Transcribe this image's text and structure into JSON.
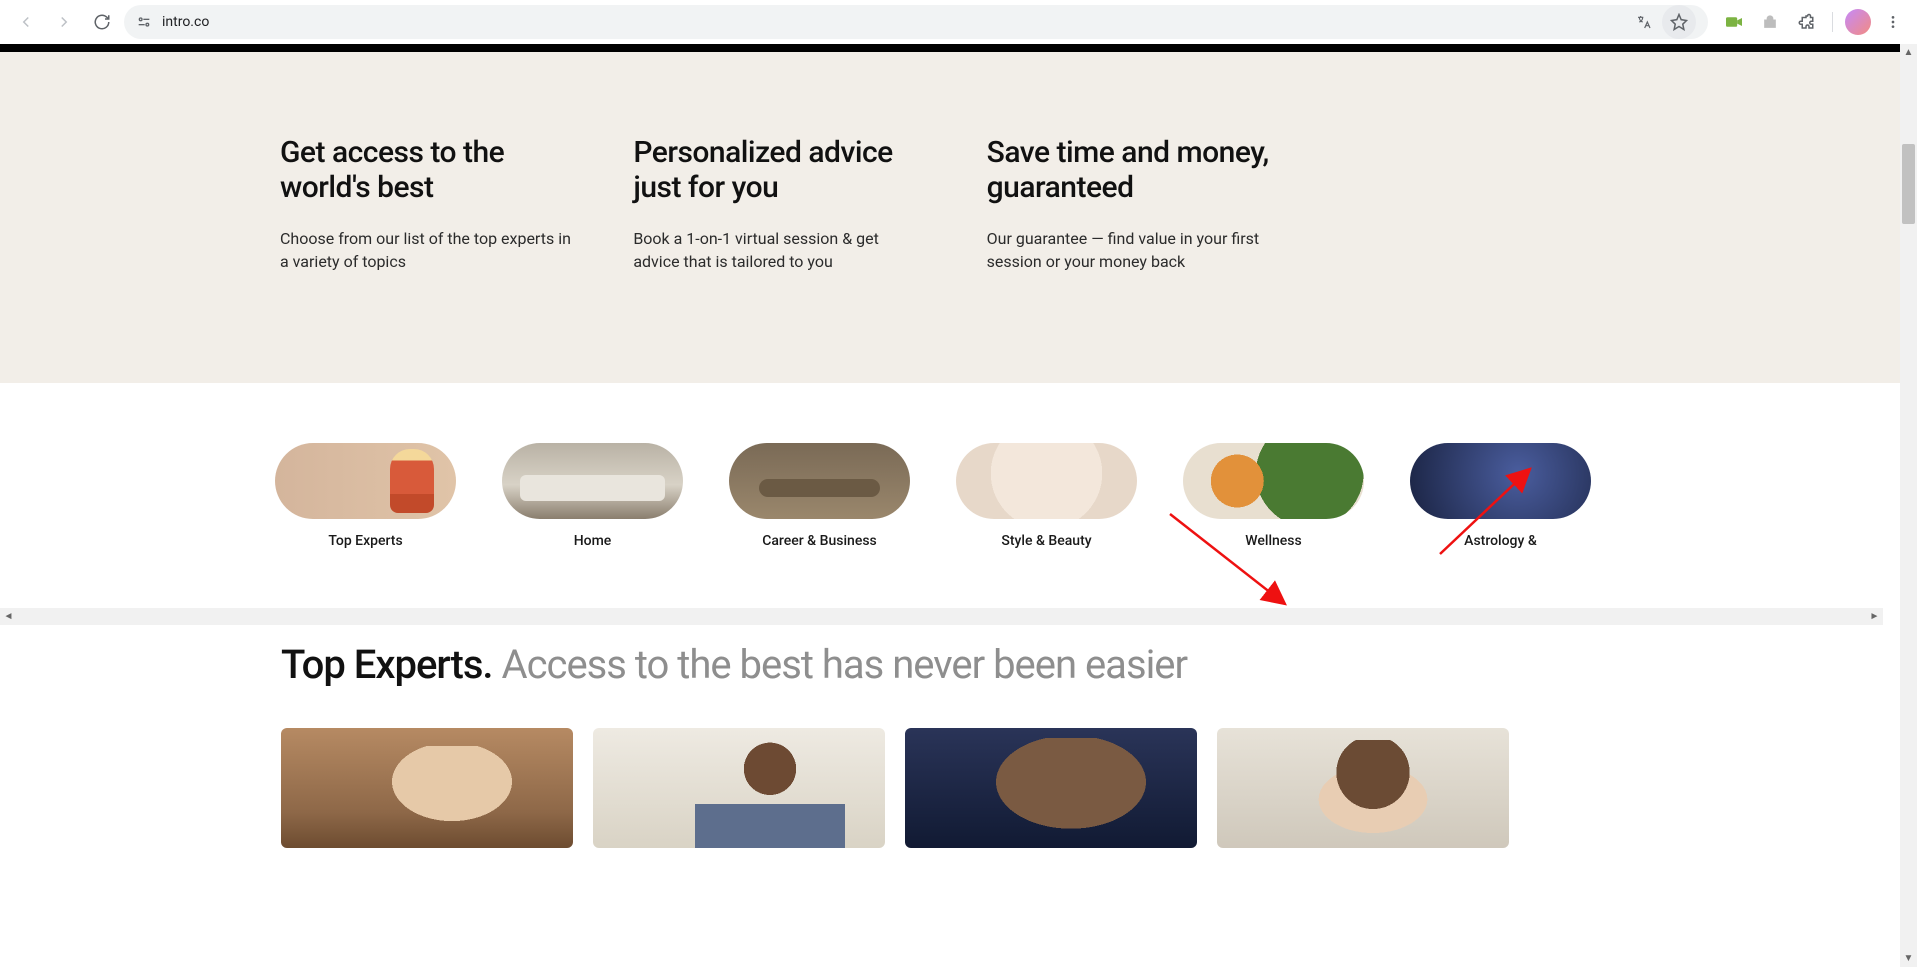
{
  "browser": {
    "url": "intro.co"
  },
  "features": [
    {
      "title": "Get access to the world's best",
      "desc": "Choose from our list of the top experts in a variety of topics"
    },
    {
      "title": "Personalized advice just for you",
      "desc": "Book a 1-on-1 virtual session & get advice that is tailored to you"
    },
    {
      "title": "Save time and money, guaranteed",
      "desc": "Our guarantee — find value in your first session or your money back"
    }
  ],
  "categories": [
    {
      "label": "Top Experts"
    },
    {
      "label": "Home"
    },
    {
      "label": "Career & Business"
    },
    {
      "label": "Style & Beauty"
    },
    {
      "label": "Wellness"
    },
    {
      "label": "Astrology &"
    }
  ],
  "top_experts": {
    "title_bold": "Top Experts.",
    "title_rest": " Access to the best has never been easier"
  }
}
